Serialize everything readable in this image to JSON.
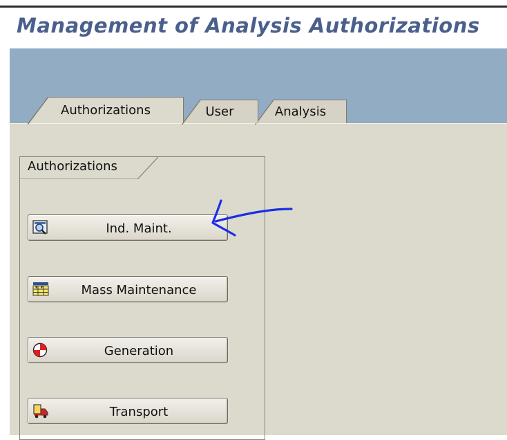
{
  "header": {
    "title": "Management of Analysis Authorizations"
  },
  "tabs": [
    {
      "label": "Authorizations",
      "active": true
    },
    {
      "label": "User",
      "active": false
    },
    {
      "label": "Analysis",
      "active": false
    }
  ],
  "group": {
    "title": "Authorizations",
    "buttons": [
      {
        "label": "Ind. Maint.",
        "icon": "magnifier-icon"
      },
      {
        "label": "Mass Maintenance",
        "icon": "table-grid-icon"
      },
      {
        "label": "Generation",
        "icon": "generate-icon"
      },
      {
        "label": "Transport",
        "icon": "truck-icon"
      }
    ]
  },
  "annotation": {
    "type": "hand-drawn-arrow",
    "color": "#1a2fe6",
    "points_to": "Ind. Maint."
  },
  "colors": {
    "title": "#4a5f8c",
    "band": "#91acc3",
    "panel": "#dcdacd"
  }
}
